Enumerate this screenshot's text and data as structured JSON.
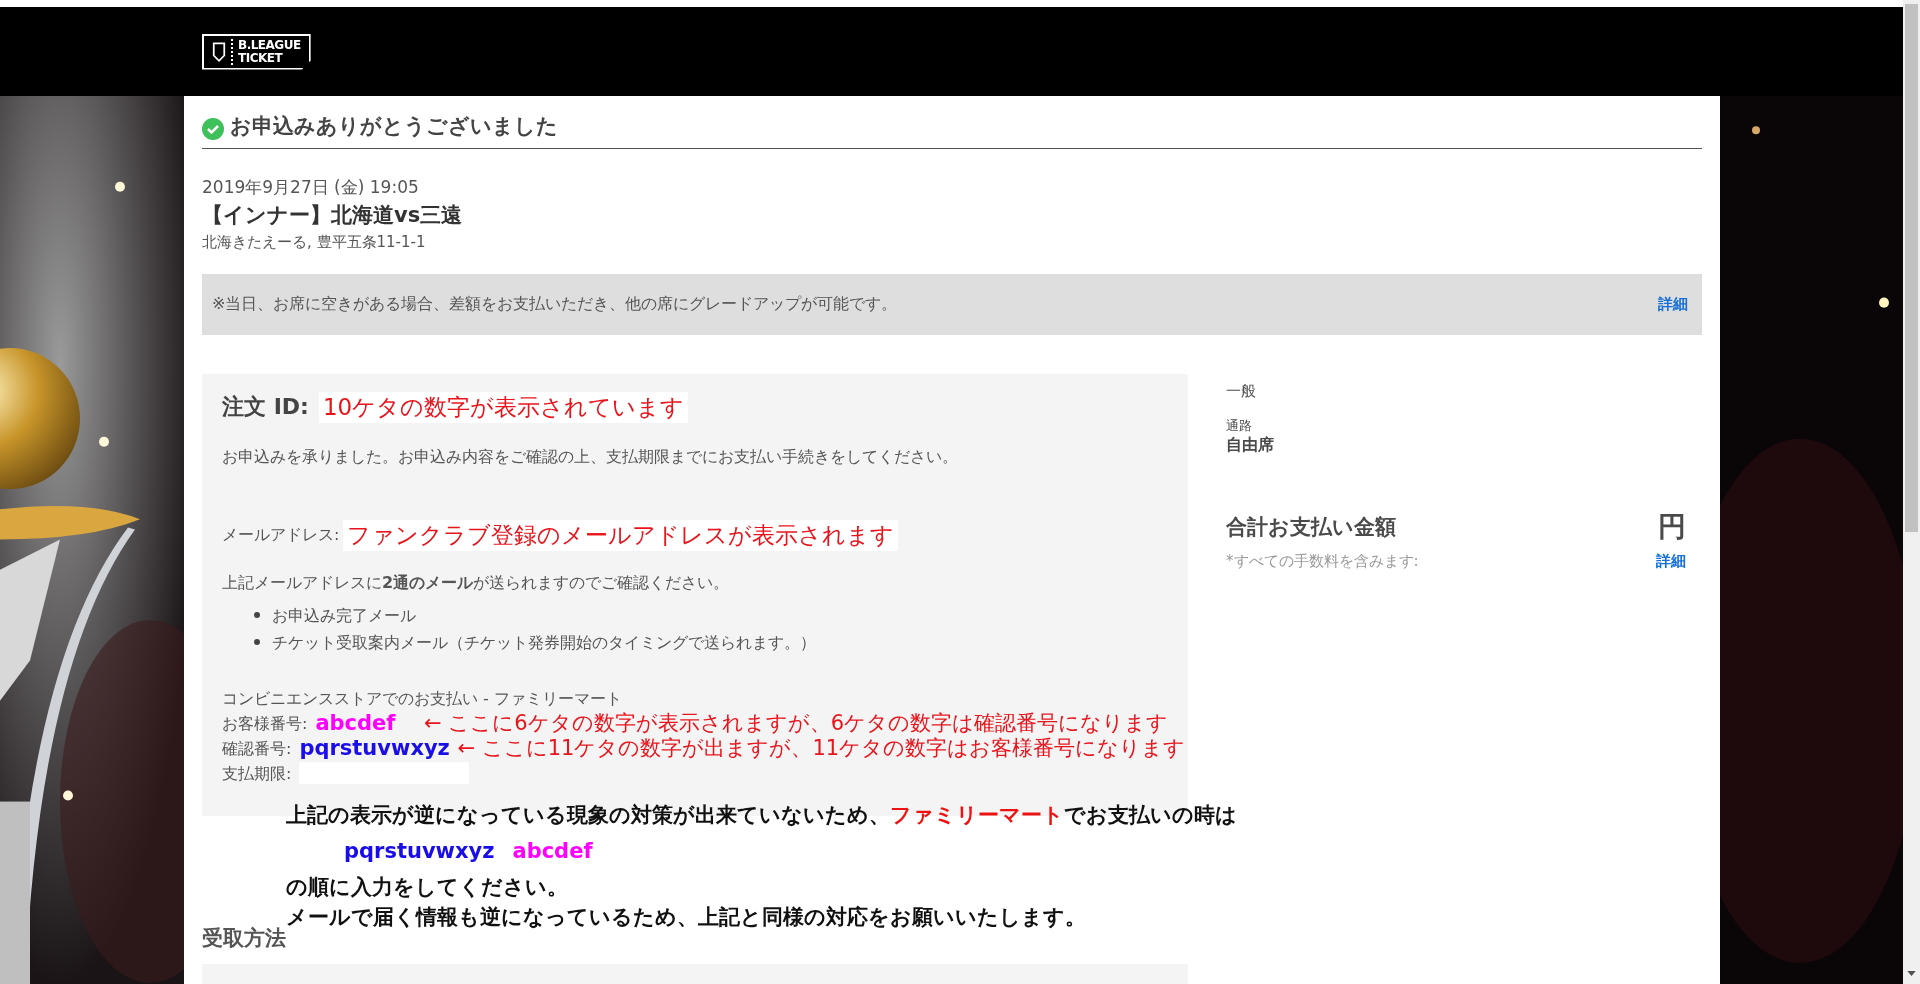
{
  "header": {
    "logo": {
      "line_1": "B.LEAGUE",
      "line_2": "TICKET"
    }
  },
  "confirmation": {
    "heading": "お申込みありがとうございました",
    "date": "2019年9月27日 (金) 19:05",
    "event": "【インナー】北海道vs三遠",
    "venue": "北海きたえーる, 豊平五条11-1-1"
  },
  "notice": {
    "text": "※当日、お席に空きがある場合、差額をお支払いただき、他の席にグレードアップが可能です。",
    "link": "詳細"
  },
  "order": {
    "id_label": "注文 ID:",
    "id_note": "10ケタの数字が表示されています",
    "message": "お申込みを承りました。お申込み内容をご確認の上、支払期限までにお支払い手続きをしてください。",
    "email_label": "メールアドレス:",
    "email_note": "ファンクラブ登録のメールアドレスが表示されます",
    "mail_info": "上記メールアドレスに**2通のメール**が送られますのでご確認ください。",
    "mails": [
      "お申込み完了メール",
      "チケット受取案内メール（チケット発券開始のタイミングで送られます。）"
    ],
    "payment_method": "コンビニエンスストアでのお支払い - ファミリーマート",
    "fields": [
      {
        "label": "お客様番号:",
        "value": "abcdef",
        "color": "#ff00ff",
        "note": "← ここに6ケタの数字が表示されますが、6ケタの数字は確認番号になります"
      },
      {
        "label": "確認番号:",
        "value": "pqrstuvwxyz",
        "color": "#1a0ee8",
        "note": "← ここに11ケタの数字が出ますが、11ケタの数字はお客様番号になります"
      },
      {
        "label": "支払期限:"
      }
    ]
  },
  "ticket": {
    "type": "一般",
    "seat_label": "通路",
    "seat": "自由席",
    "total_label": "合計お支払い金額",
    "total": "円",
    "fee_note": "*すべての手数料を含みます:",
    "link": "詳細"
  },
  "annotation": {
    "line_1": {
      "before": "上記の表示が逆になっている現象の対策が出来ていないため、",
      "highlight": "ファミリーマート",
      "after": "でお支払いの時は"
    },
    "order": [
      {
        "text": "pqrstuvwxyz",
        "color": "#1a0ee8"
      },
      {
        "text": "abcdef",
        "color": "#ff00ff"
      }
    ],
    "line_3": "の順に入力をしてください。",
    "line_4": "メールで届く情報も逆になっているため、上記と同様の対応をお願いいたします。"
  },
  "section_heading": "受取方法"
}
